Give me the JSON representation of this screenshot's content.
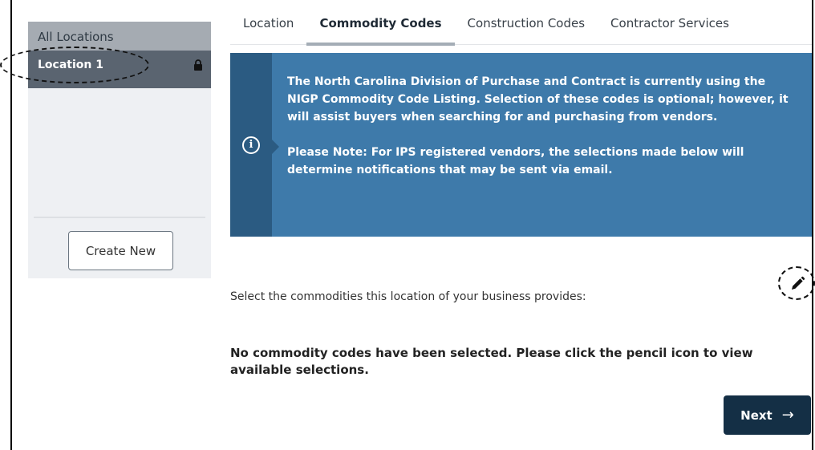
{
  "sidebar": {
    "all_locations_label": "All Locations",
    "items": [
      {
        "label": "Location 1",
        "icon": "lock-icon"
      }
    ],
    "create_new_label": "Create New"
  },
  "tabs": [
    {
      "label": "Location",
      "active": false
    },
    {
      "label": "Commodity Codes",
      "active": true
    },
    {
      "label": "Construction Codes",
      "active": false
    },
    {
      "label": "Contractor Services",
      "active": false
    }
  ],
  "banner": {
    "icon": "info-icon",
    "paragraph1": "The North Carolina Division of Purchase and Contract is currently using the NIGP Commodity Code Listing. Selection of these codes is optional; however, it will assist buyers when searching for and purchasing from vendors.",
    "paragraph2": "Please Note: For IPS registered vendors, the selections made below will determine notifications that may be sent via email."
  },
  "main": {
    "select_label": "Select the commodities this location of your business provides:",
    "edit_icon": "pencil-icon",
    "no_codes_message": "No commodity codes have been selected. Please click the pencil icon to view available selections.",
    "next_label": "Next",
    "next_arrow": "→"
  },
  "colors": {
    "banner_bg": "#3e7aaa",
    "banner_strip": "#2b5b82",
    "next_button": "#142f45",
    "sidebar_active": "#5a6470"
  }
}
